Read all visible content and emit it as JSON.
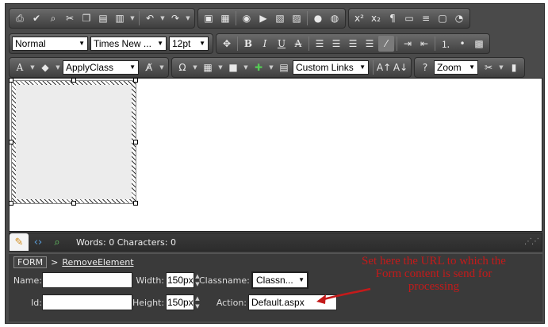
{
  "toolbar": {
    "style_select": "Normal",
    "font_select": "Times New ...",
    "size_select": "12pt",
    "class_select": "ApplyClass",
    "links_select": "Custom Links",
    "zoom_select": "Zoom"
  },
  "status": {
    "words": "Words: 0 Characters: 0"
  },
  "breadcrumb": {
    "tag": "FORM",
    "separator": ">",
    "remove": "RemoveElement"
  },
  "properties": {
    "name_label": "Name:",
    "name_value": "",
    "width_label": "Width:",
    "width_value": "150px",
    "classname_label": "Classname:",
    "classname_value": "Classn...",
    "id_label": "Id:",
    "id_value": "",
    "height_label": "Height:",
    "height_value": "150px",
    "action_label": "Action:",
    "action_value": "Default.aspx"
  },
  "annotation": {
    "text": "Set here the URL to which the Form content is send for processing",
    "color": "#c41a1a"
  }
}
